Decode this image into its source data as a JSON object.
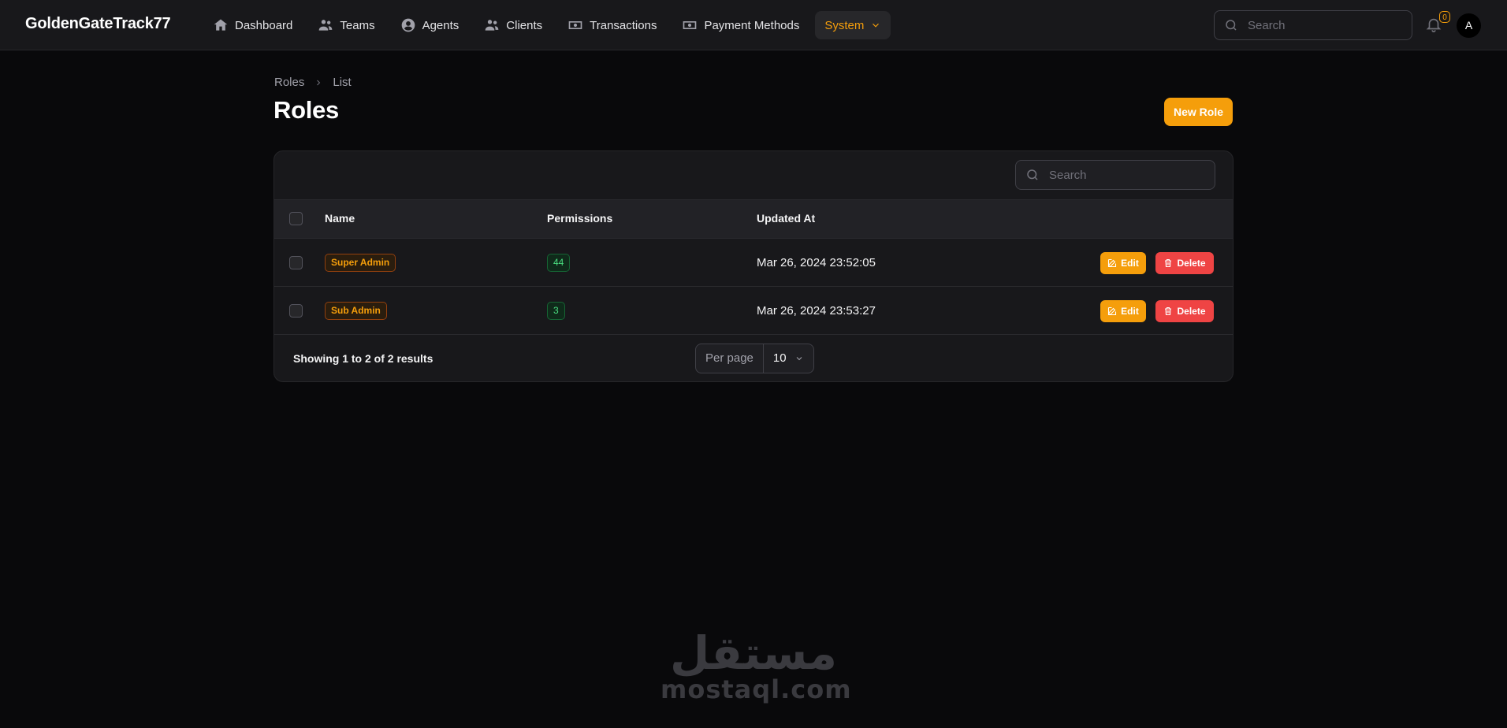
{
  "app": {
    "brand": "GoldenGateTrack77"
  },
  "nav": {
    "items": [
      {
        "label": "Dashboard",
        "icon": "home-icon"
      },
      {
        "label": "Teams",
        "icon": "users-icon"
      },
      {
        "label": "Agents",
        "icon": "user-circle-icon"
      },
      {
        "label": "Clients",
        "icon": "users-icon"
      },
      {
        "label": "Transactions",
        "icon": "banknote-icon"
      },
      {
        "label": "Payment Methods",
        "icon": "banknote-icon"
      },
      {
        "label": "System",
        "icon": "chevron-down-icon",
        "active": true
      }
    ]
  },
  "header": {
    "search_placeholder": "Search",
    "notifications_count": "0",
    "avatar_initial": "A"
  },
  "breadcrumb": {
    "root": "Roles",
    "current": "List"
  },
  "page": {
    "title": "Roles",
    "new_button": "New Role"
  },
  "table": {
    "search_placeholder": "Search",
    "columns": {
      "name": "Name",
      "permissions": "Permissions",
      "updated_at": "Updated At"
    },
    "rows": [
      {
        "name": "Super Admin",
        "permissions": "44",
        "updated_at": "Mar 26, 2024 23:52:05",
        "edit": "Edit",
        "delete": "Delete"
      },
      {
        "name": "Sub Admin",
        "permissions": "3",
        "updated_at": "Mar 26, 2024 23:53:27",
        "edit": "Edit",
        "delete": "Delete"
      }
    ],
    "footer": {
      "summary": "Showing 1 to 2 of 2 results",
      "per_page_label": "Per page",
      "per_page_value": "10"
    }
  },
  "watermark": {
    "arabic": "مستقل",
    "latin": "mostaql.com"
  },
  "colors": {
    "accent": "#f59e0b",
    "danger": "#ef4444",
    "success": "#4ade80",
    "background": "#09090b"
  }
}
